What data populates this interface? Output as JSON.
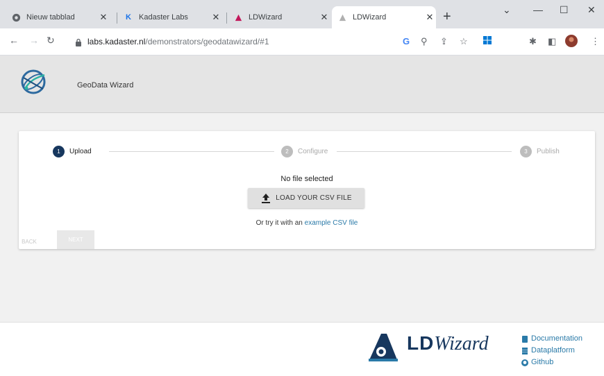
{
  "browser": {
    "tabs": [
      {
        "title": "Nieuw tabblad",
        "icon": "chrome-icon"
      },
      {
        "title": "Kadaster Labs",
        "icon": "kadaster-icon"
      },
      {
        "title": "LDWizard",
        "icon": "ldwizard-icon"
      },
      {
        "title": "LDWizard",
        "icon": "ldwizard-faded-icon",
        "active": true
      }
    ],
    "url_domain": "labs.kadaster.nl",
    "url_path": "/demonstrators/geodatawizard/#1",
    "google_letter": "G"
  },
  "app": {
    "title": "GeoData Wizard"
  },
  "stepper": {
    "steps": [
      {
        "num": "1",
        "label": "Upload",
        "state": "active"
      },
      {
        "num": "2",
        "label": "Configure",
        "state": "inactive"
      },
      {
        "num": "3",
        "label": "Publish",
        "state": "inactive"
      }
    ],
    "back_label": "BACK",
    "next_label": "NEXT"
  },
  "upload": {
    "status": "No file selected",
    "button_label": "LOAD YOUR CSV FILE",
    "try_prefix": "Or try it with an",
    "try_link": "example CSV file"
  },
  "footer": {
    "brand_ld": "LD",
    "brand_wizard": "Wizard",
    "links": [
      "Documentation",
      "Dataplatform",
      "Github"
    ]
  },
  "colors": {
    "primary": "#17375e",
    "link": "#2a7aa8",
    "step_inactive": "#bdbdbd"
  }
}
